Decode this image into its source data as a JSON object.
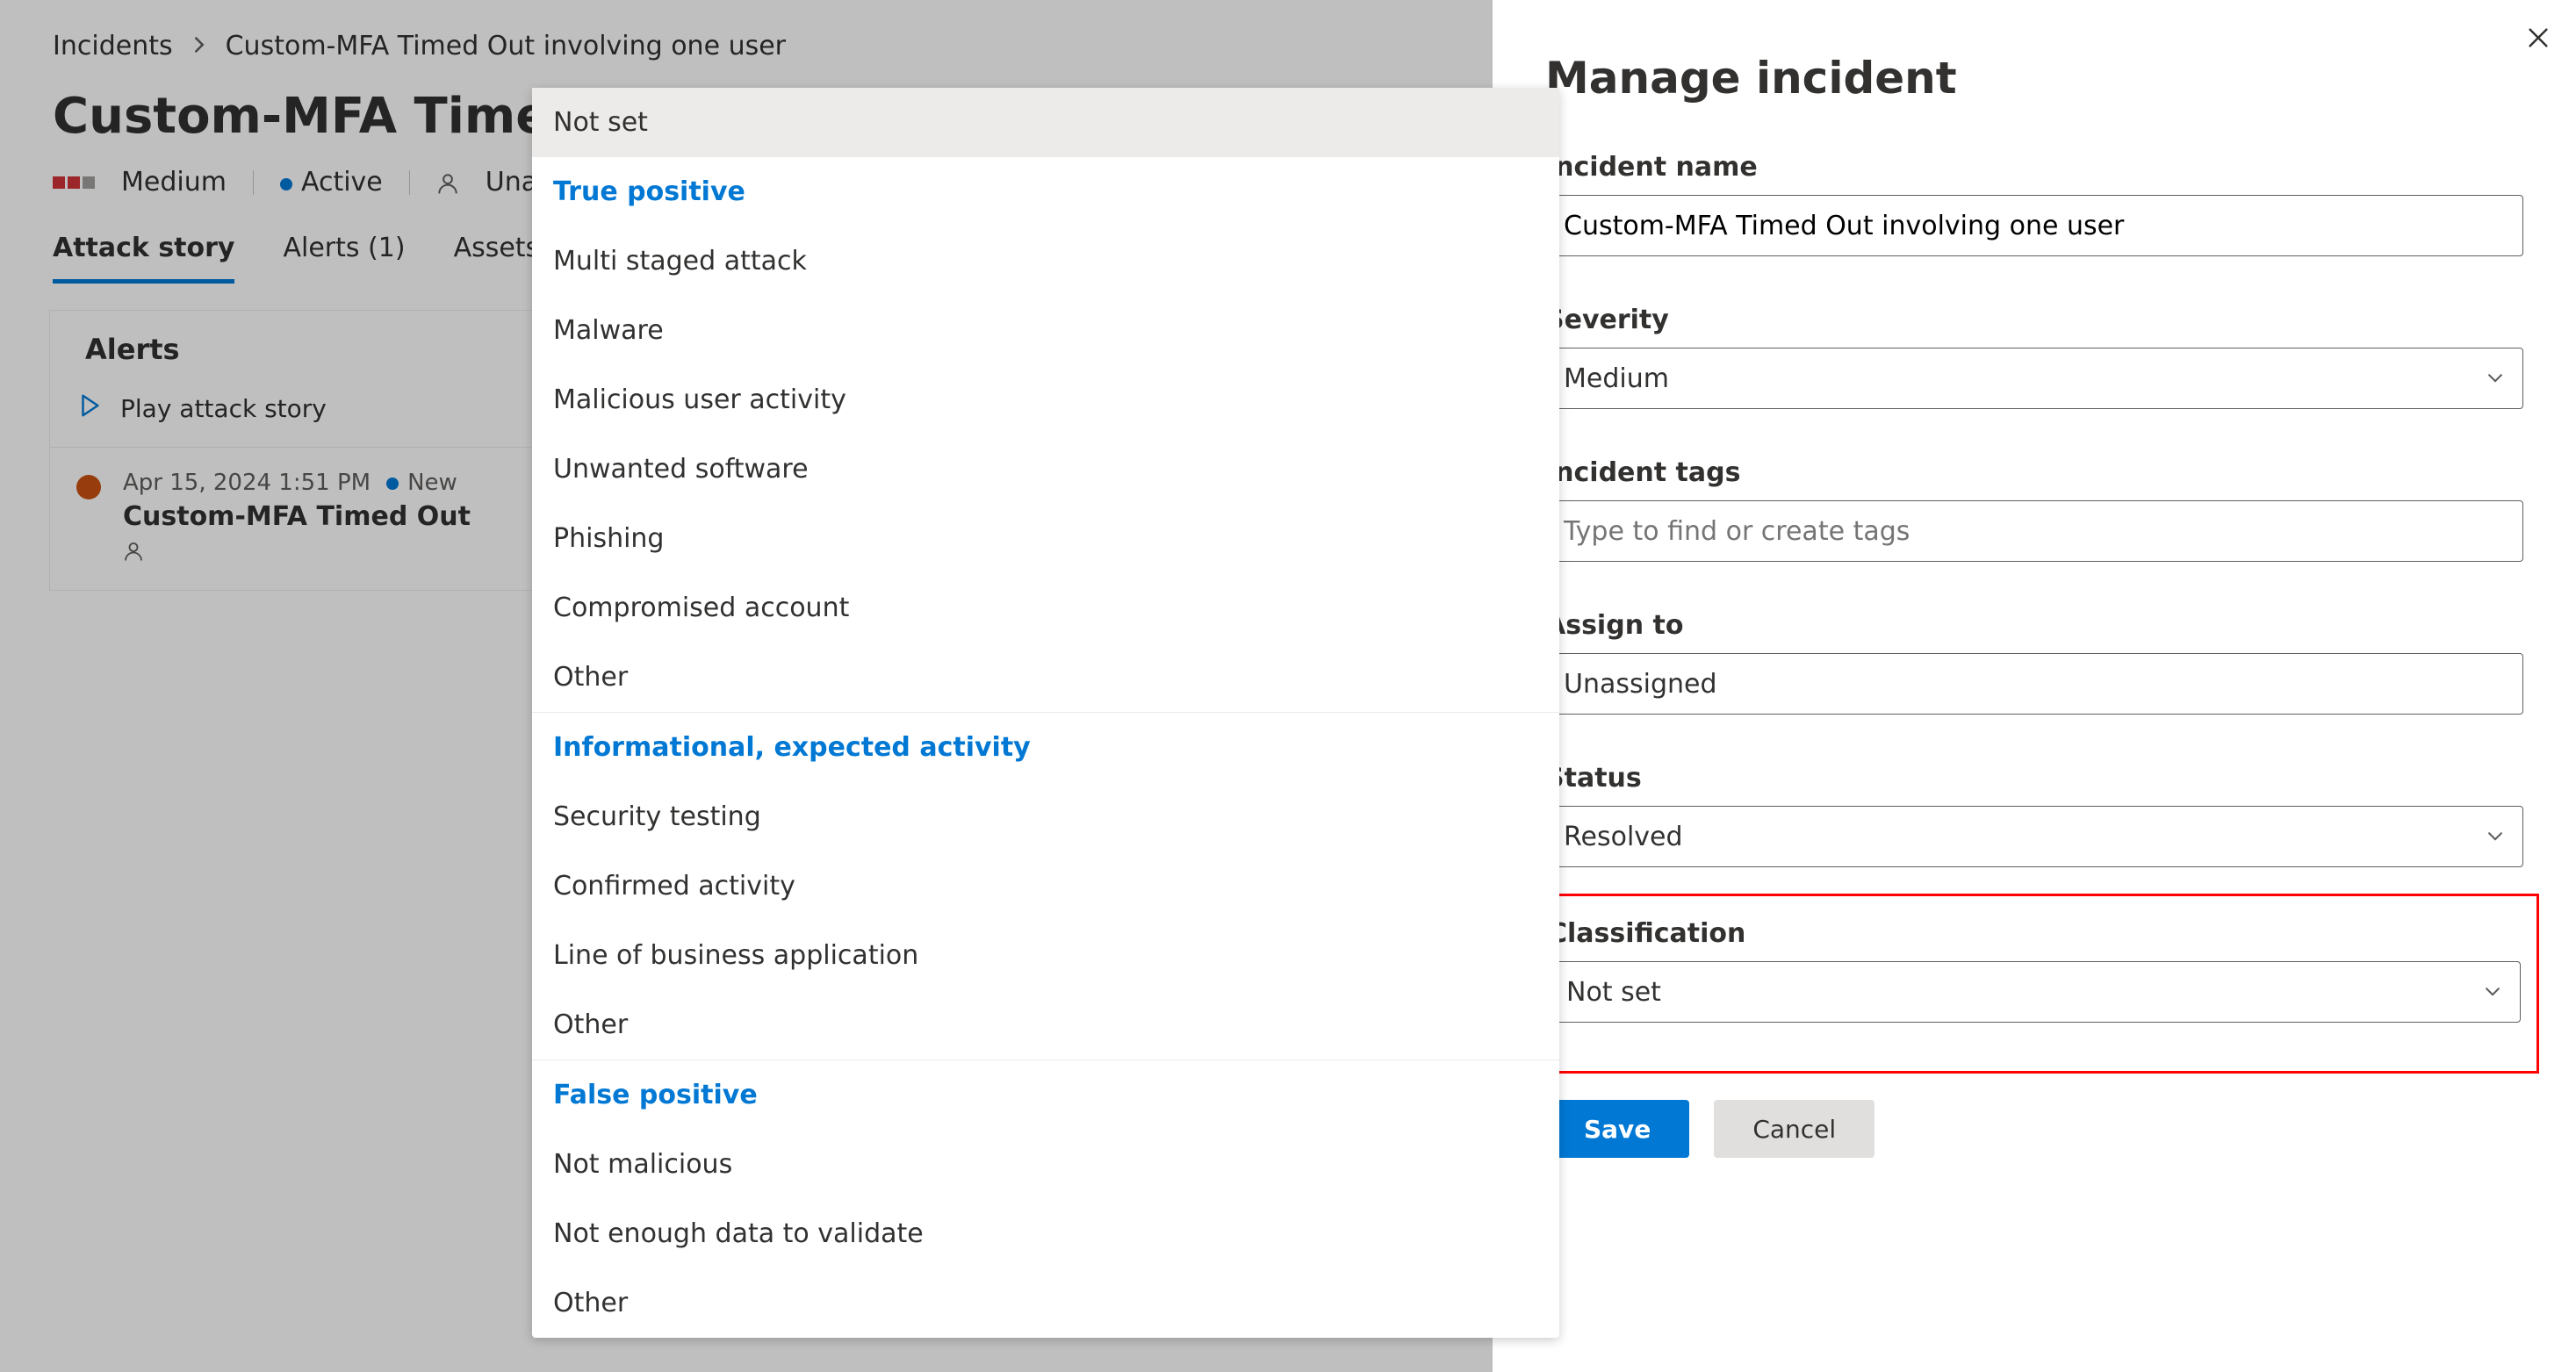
{
  "breadcrumb": {
    "root": "Incidents",
    "current": "Custom-MFA Timed Out involving one user"
  },
  "page_title": "Custom-MFA Timed Out involving one user",
  "status": {
    "severity": "Medium",
    "state": "Active",
    "assignment": "Unassigned"
  },
  "tabs": {
    "attack_story": "Attack story",
    "alerts": "Alerts (1)",
    "assets": "Assets"
  },
  "alerts": {
    "header": "Alerts",
    "play_label": "Play attack story",
    "pin_label": "Un",
    "row": {
      "time": "Apr 15, 2024 1:51 PM",
      "state": "New",
      "title": "Custom-MFA Timed Out"
    }
  },
  "dropdown": {
    "not_set": "Not set",
    "group_tp": "True positive",
    "tp": {
      "multi": "Multi staged attack",
      "malware": "Malware",
      "mal_user": "Malicious user activity",
      "unwanted": "Unwanted software",
      "phishing": "Phishing",
      "compromised": "Compromised account",
      "other": "Other"
    },
    "group_info": "Informational, expected activity",
    "info": {
      "sectest": "Security testing",
      "confirmed": "Confirmed activity",
      "lob": "Line of business application",
      "other": "Other"
    },
    "group_fp": "False positive",
    "fp": {
      "notmal": "Not malicious",
      "notenough": "Not enough data to validate",
      "other": "Other"
    }
  },
  "panel": {
    "title": "Manage incident",
    "incident_name_label": "Incident name",
    "incident_name_value": "Custom-MFA Timed Out involving one user",
    "severity_label": "Severity",
    "severity_value": "Medium",
    "tags_label": "Incident tags",
    "tags_placeholder": "Type to find or create tags",
    "assign_label": "Assign to",
    "assign_value": "Unassigned",
    "status_label": "Status",
    "status_value": "Resolved",
    "classification_label": "Classification",
    "classification_value": "Not set",
    "save": "Save",
    "cancel": "Cancel"
  }
}
